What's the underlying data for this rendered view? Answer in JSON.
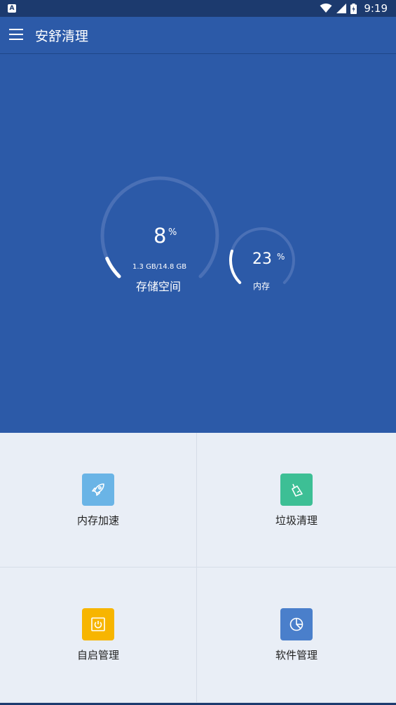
{
  "status_bar": {
    "time": "9:19",
    "app_icon": "A"
  },
  "app_bar": {
    "title": "安舒清理"
  },
  "storage_gauge": {
    "percent": "8",
    "percent_sign": "%",
    "detail": "1.3 GB/14.8 GB",
    "label": "存储空间",
    "fraction": 0.08
  },
  "memory_gauge": {
    "percent": "23",
    "percent_sign": "%",
    "label": "内存",
    "fraction": 0.23
  },
  "tiles": [
    {
      "label": "内存加速",
      "icon": "rocket-icon",
      "color": "#6ab4e6"
    },
    {
      "label": "垃圾清理",
      "icon": "broom-icon",
      "color": "#3dbf95"
    },
    {
      "label": "自启管理",
      "icon": "power-icon",
      "color": "#f7b500"
    },
    {
      "label": "软件管理",
      "icon": "pie-chart-icon",
      "color": "#4a7fcb"
    }
  ]
}
